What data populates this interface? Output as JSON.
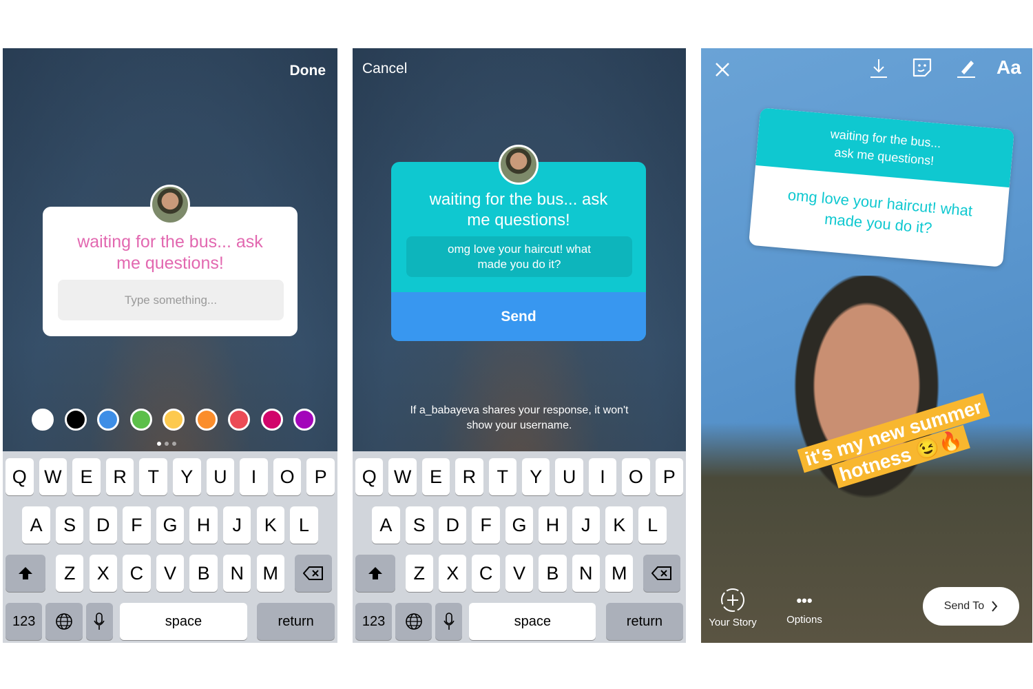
{
  "panel1": {
    "done": "Done",
    "question": "waiting for the bus... ask me questions!",
    "placeholder": "Type something...",
    "question_color": "#e268b0",
    "colors": [
      "#ffffff",
      "#000000",
      "#3e8ee6",
      "#5cbf4a",
      "#fdc94e",
      "#fb8d2b",
      "#ec4b56",
      "#d1056b",
      "#a306ba"
    ]
  },
  "panel2": {
    "cancel": "Cancel",
    "question": "waiting for the bus... ask me questions!",
    "answer": "omg love your haircut! what made you do it?",
    "send": "Send",
    "notice": "If a_babayeva shares your response, it won't show your username.",
    "accent": "#0fc8d0",
    "send_color": "#3897f0"
  },
  "panel3": {
    "question": "waiting for the bus... ask me questions!",
    "answer": "omg love your haircut! what made you do it?",
    "caption": "it's my new summer hotness 😉🔥",
    "text_tool": "Aa",
    "your_story": "Your Story",
    "options": "Options",
    "send_to": "Send To"
  },
  "keyboard": {
    "row1": [
      "Q",
      "W",
      "E",
      "R",
      "T",
      "Y",
      "U",
      "I",
      "O",
      "P"
    ],
    "row2": [
      "A",
      "S",
      "D",
      "F",
      "G",
      "H",
      "J",
      "K",
      "L"
    ],
    "row3": [
      "Z",
      "X",
      "C",
      "V",
      "B",
      "N",
      "M"
    ],
    "num": "123",
    "space": "space",
    "return": "return"
  }
}
